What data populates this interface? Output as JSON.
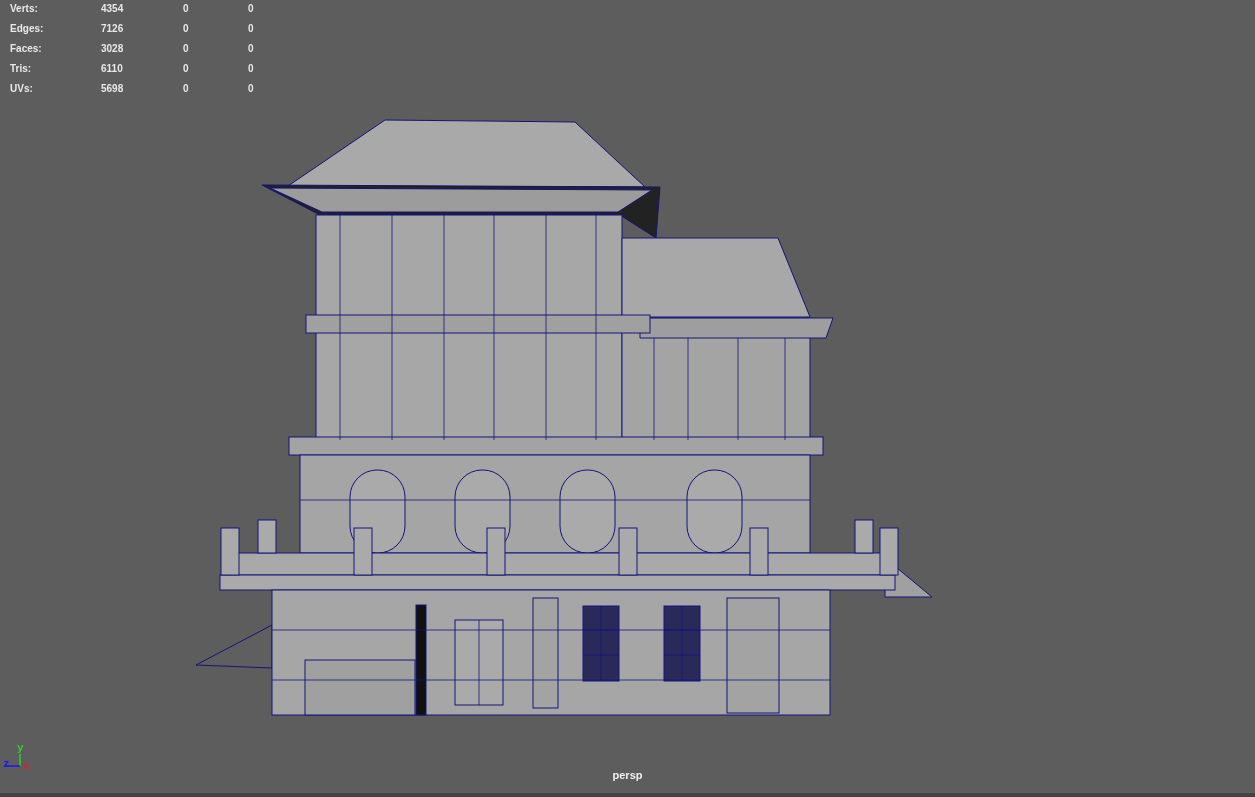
{
  "heads_up_display": {
    "stats": [
      {
        "label": "Verts:",
        "values": [
          "4354",
          "0",
          "0"
        ]
      },
      {
        "label": "Edges:",
        "values": [
          "7126",
          "0",
          "0"
        ]
      },
      {
        "label": "Faces:",
        "values": [
          "3028",
          "0",
          "0"
        ]
      },
      {
        "label": "Tris:",
        "values": [
          "6110",
          "0",
          "0"
        ]
      },
      {
        "label": "UVs:",
        "values": [
          "5698",
          "0",
          "0"
        ]
      }
    ]
  },
  "axis_gizmo": [
    {
      "label": "y",
      "color": "#2ed12e"
    },
    {
      "label": "z",
      "color": "#1a1af0"
    },
    {
      "label": "x",
      "color": "#e02020"
    }
  ],
  "camera_label": "persp"
}
